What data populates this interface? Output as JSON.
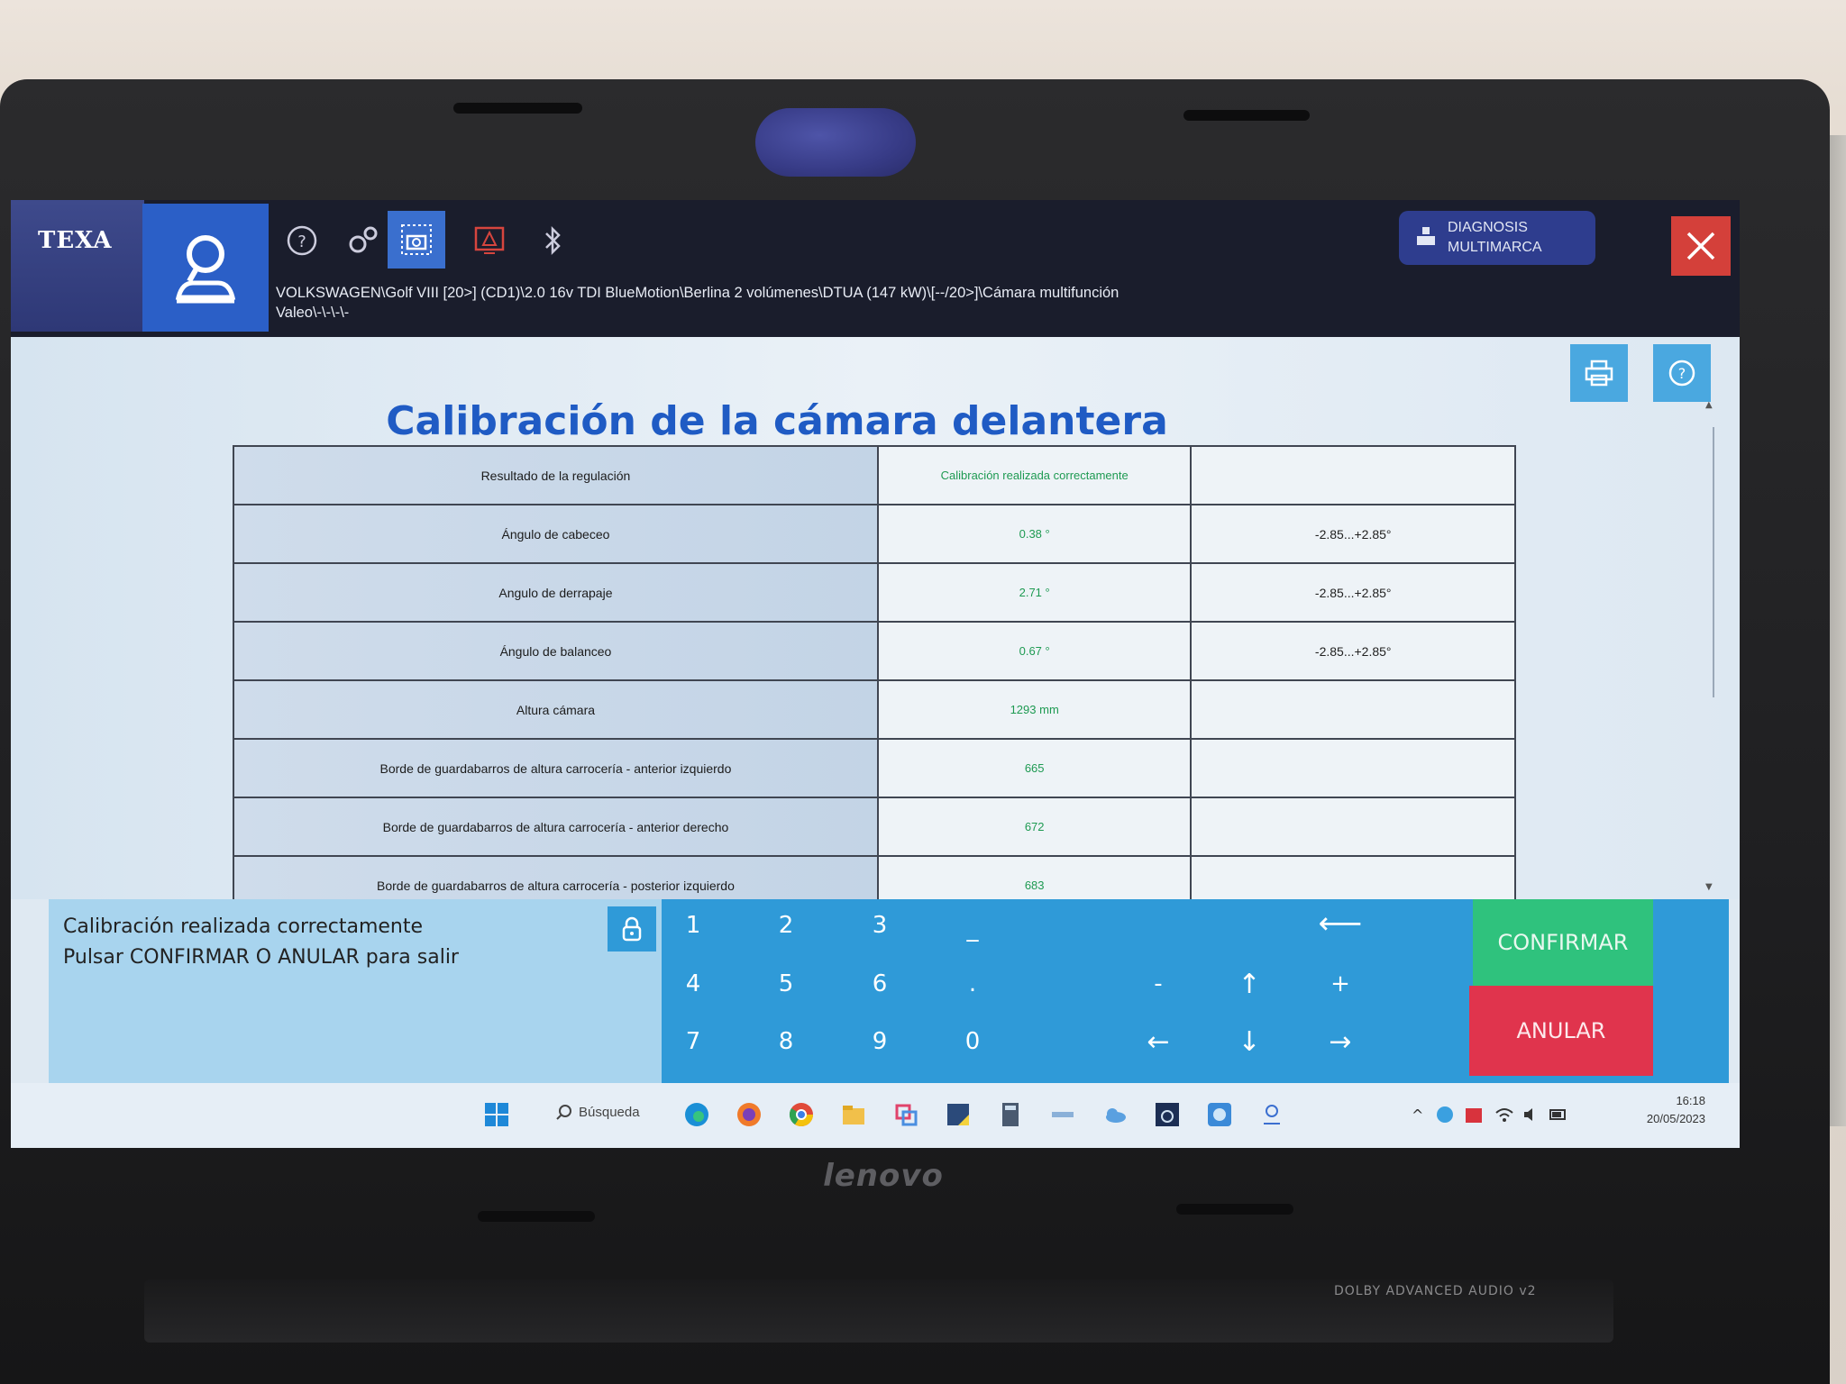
{
  "header": {
    "logo_text": "TEXA",
    "breadcrumb_line1": "VOLKSWAGEN\\Golf VIII [20>] (CD1)\\2.0 16v TDI BlueMotion\\Berlina 2 volúmenes\\DTUA (147 kW)\\[--/20>]\\Cámara multifunción",
    "breadcrumb_line2": "Valeo\\-\\-\\-\\-",
    "mode_button_line1": "DIAGNOSIS",
    "mode_button_line2": "MULTIMARCA"
  },
  "page": {
    "title": "Calibración de la cámara delantera"
  },
  "table": {
    "rows": [
      {
        "name": "Resultado de la regulación",
        "value": "Calibración realizada correctamente",
        "range": ""
      },
      {
        "name": "Ángulo de cabeceo",
        "value": "0.38 °",
        "range": "-2.85...+2.85°"
      },
      {
        "name": "Angulo de derrapaje",
        "value": "2.71 °",
        "range": "-2.85...+2.85°"
      },
      {
        "name": "Ángulo de balanceo",
        "value": "0.67 °",
        "range": "-2.85...+2.85°"
      },
      {
        "name": "Altura cámara",
        "value": "1293 mm",
        "range": ""
      },
      {
        "name": "Borde de guardabarros de altura carrocería - anterior izquierdo",
        "value": "665",
        "range": ""
      },
      {
        "name": "Borde de guardabarros de altura carrocería - anterior derecho",
        "value": "672",
        "range": ""
      },
      {
        "name": "Borde de guardabarros de altura carrocería - posterior izquierdo",
        "value": "683",
        "range": ""
      }
    ]
  },
  "message": {
    "line1": "Calibración realizada correctamente",
    "line2": "Pulsar CONFIRMAR O ANULAR para salir"
  },
  "keypad": {
    "keys": [
      "1",
      "2",
      "3",
      "_",
      "4",
      "5",
      "6",
      ".",
      "7",
      "8",
      "9",
      "0"
    ],
    "minus": "-",
    "plus": "+",
    "backspace": "⟵",
    "up": "↑",
    "down": "↓",
    "left": "←",
    "right": "→"
  },
  "actions": {
    "confirm": "CONFIRMAR",
    "cancel": "ANULAR"
  },
  "taskbar": {
    "search_label": "Búsqueda",
    "time": "16:18",
    "date": "20/05/2023"
  },
  "device": {
    "brand": "lenovo",
    "audio_label": "DOLBY ADVANCED AUDIO v2"
  },
  "colors": {
    "accent_blue": "#2b5fc7",
    "title_blue": "#1f5bc4",
    "confirm_green": "#2fc27d",
    "cancel_red": "#e0344d",
    "value_green": "#1e9a52"
  }
}
